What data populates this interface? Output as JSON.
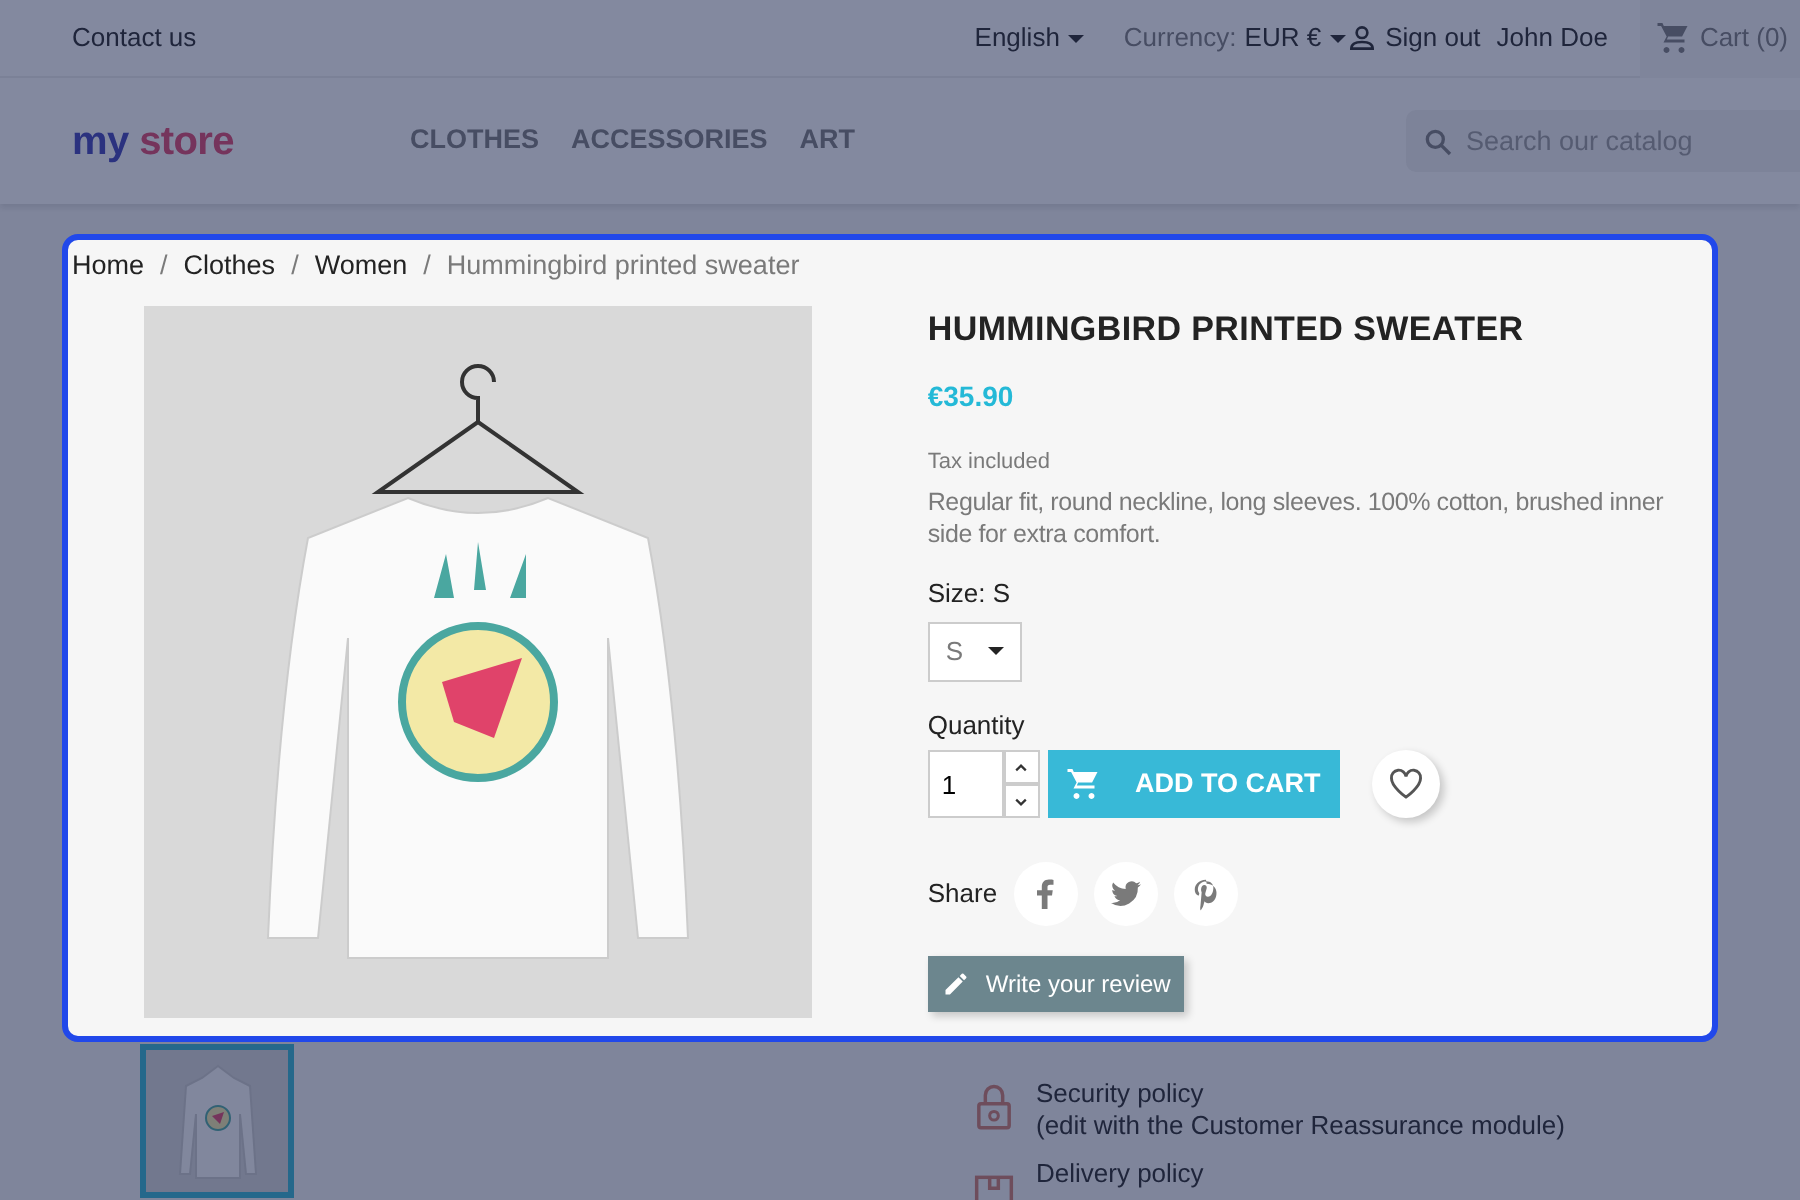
{
  "top_bar": {
    "contact": "Contact us",
    "language": "English",
    "currency_label": "Currency:",
    "currency": "EUR €",
    "sign_out": "Sign out",
    "user": "John Doe",
    "cart": "Cart (0)"
  },
  "logo": {
    "first": "my",
    "second": "store"
  },
  "nav": [
    "CLOTHES",
    "ACCESSORIES",
    "ART"
  ],
  "search": {
    "placeholder": "Search our catalog"
  },
  "breadcrumb": [
    {
      "label": "Home",
      "current": false
    },
    {
      "separator": "/",
      "label": "Clothes",
      "current": false
    },
    {
      "separator": "/",
      "label": "Women",
      "current": false
    },
    {
      "separator": "/",
      "label": "Hummingbird printed sweater",
      "current": true
    }
  ],
  "product": {
    "title": "HUMMINGBIRD PRINTED SWEATER",
    "price": "€35.90",
    "tax_note": "Tax included",
    "description": "Regular fit, round neckline, long sleeves. 100% cotton, brushed inner side for extra comfort.",
    "size_label": "Size: S",
    "size_value": "S",
    "quantity_label": "Quantity",
    "quantity": "1",
    "add_to_cart": "ADD TO CART",
    "share_label": "Share",
    "review_button": "Write your review"
  },
  "thumbnails": [
    {
      "selected": true
    }
  ],
  "policies": [
    {
      "kind": "security",
      "title": "Security policy",
      "note": "(edit with the Customer Reassurance module)"
    },
    {
      "kind": "delivery",
      "title": "Delivery policy"
    }
  ]
}
